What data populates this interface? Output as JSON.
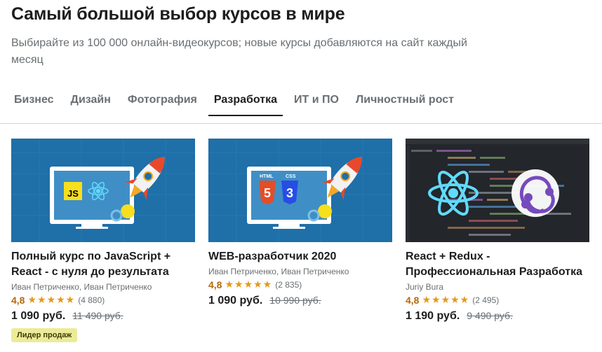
{
  "header": {
    "title": "Самый большой выбор курсов в мире",
    "subtitle": "Выбирайте из 100 000 онлайн-видеокурсов; новые курсы добавляются на сайт каждый месяц"
  },
  "tabs": [
    {
      "label": "Бизнес",
      "active": false
    },
    {
      "label": "Дизайн",
      "active": false
    },
    {
      "label": "Фотография",
      "active": false
    },
    {
      "label": "Разработка",
      "active": true
    },
    {
      "label": "ИТ и ПО",
      "active": false
    },
    {
      "label": "Личностный рост",
      "active": false
    }
  ],
  "courses": [
    {
      "title": "Полный курс по JavaScript + React - с нуля до результата",
      "author": "Иван Петриченко, Иван Петриченко",
      "rating": "4,8",
      "stars": "★★★★★",
      "reviews": "(4 880)",
      "price": "1 090 руб.",
      "old_price": "11 490 руб.",
      "badge": "Лидер продаж",
      "thumb_text": "JS"
    },
    {
      "title": "WEB-разработчик 2020",
      "author": "Иван Петриченко, Иван Петриченко",
      "rating": "4,8",
      "stars": "★★★★★",
      "reviews": "(2 835)",
      "price": "1 090 руб.",
      "old_price": "10 990 руб.",
      "thumb_text": [
        "HTML",
        "CSS",
        "5",
        "3"
      ]
    },
    {
      "title": "React + Redux - Профессиональная Разработка",
      "author": "Juriy Bura",
      "rating": "4,8",
      "stars": "★★★★★",
      "reviews": "(2 495)",
      "price": "1 190 руб.",
      "old_price": "9 490 руб."
    }
  ],
  "colors": {
    "thumb_blue": "#1f6fa8",
    "rating_orange": "#b4690e",
    "star": "#e59819",
    "badge_bg": "#eceb98",
    "react_cyan": "#61dafb",
    "redux_purple": "#764abc"
  }
}
